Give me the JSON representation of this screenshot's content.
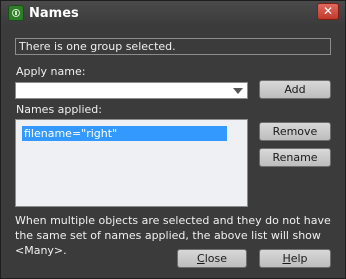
{
  "window": {
    "title": "Names",
    "close_label": "✕"
  },
  "status": {
    "text": "There is one group selected."
  },
  "apply_name": {
    "label": "Apply name:",
    "value": ""
  },
  "buttons": {
    "add": "Add",
    "remove": "Remove",
    "rename": "Rename",
    "close_first": "C",
    "close_rest": "lose",
    "help_first": "H",
    "help_rest": "elp"
  },
  "names_applied": {
    "label": "Names applied:",
    "items": [
      "filename=\"right\""
    ]
  },
  "info": {
    "text": "When multiple objects are selected and they do not have the same set of names applied, the above list will show <Many>."
  },
  "icons": {
    "app": "names-app-icon",
    "close": "close-icon",
    "dropdown": "chevron-down-icon"
  }
}
